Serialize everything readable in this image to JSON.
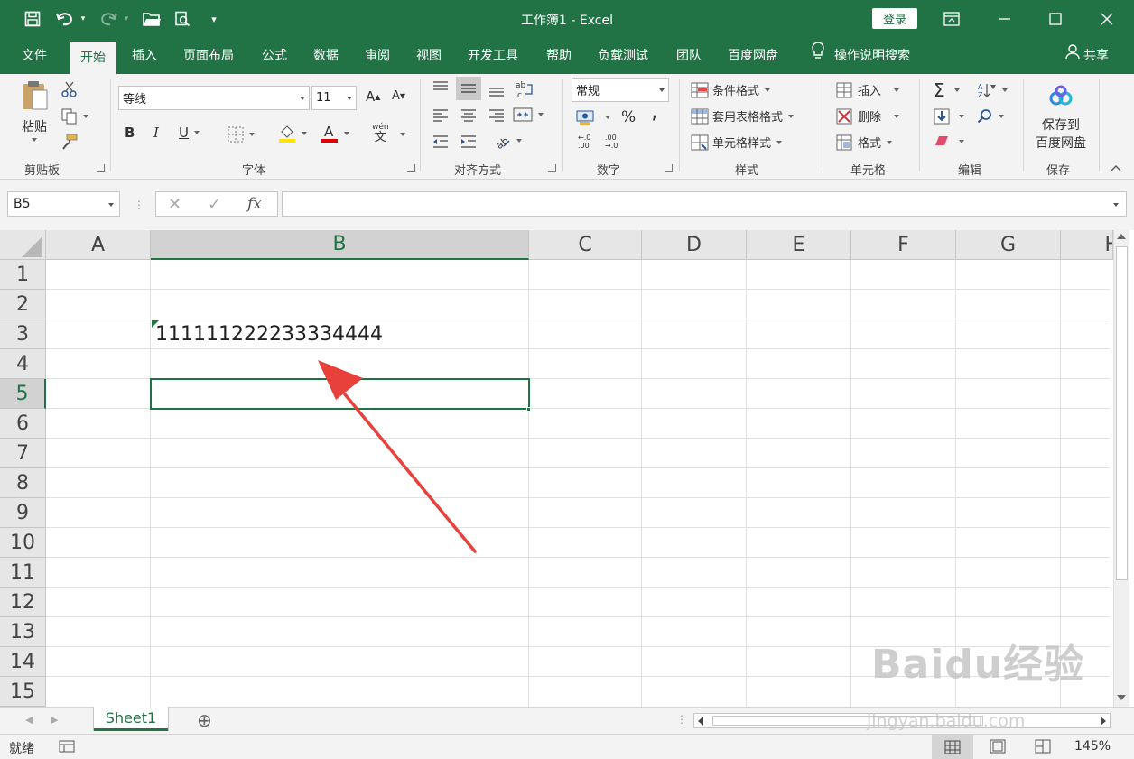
{
  "title": {
    "doc": "工作簿1",
    "sep": "-",
    "app": "Excel",
    "login": "登录"
  },
  "menu": {
    "tabs": [
      "文件",
      "开始",
      "插入",
      "页面布局",
      "公式",
      "数据",
      "审阅",
      "视图",
      "开发工具",
      "帮助",
      "负载测试",
      "团队",
      "百度网盘"
    ],
    "search": "操作说明搜索",
    "share": "共享"
  },
  "ribbon": {
    "clipboard": {
      "paste": "粘贴",
      "label": "剪贴板"
    },
    "font": {
      "name": "等线",
      "size": "11",
      "bold": "B",
      "italic": "I",
      "underline": "U",
      "grow": "A",
      "shrink": "A",
      "label": "字体",
      "phonetic_top": "wén",
      "phonetic_bottom": "文"
    },
    "alignment": {
      "label": "对齐方式"
    },
    "number": {
      "format": "常规",
      "percent": "%",
      "comma": ",",
      "inc_top": "←.0",
      "inc_bottom": ".00",
      "dec_top": ".00",
      "dec_bottom": "→.0",
      "label": "数字"
    },
    "styles": {
      "conditional": "条件格式",
      "table": "套用表格格式",
      "cell": "单元格样式",
      "label": "样式"
    },
    "cells": {
      "insert": "插入",
      "delete": "删除",
      "format": "格式",
      "label": "单元格"
    },
    "editing": {
      "label": "编辑"
    },
    "save": {
      "line1": "保存到",
      "line2": "百度网盘",
      "label": "保存"
    }
  },
  "formula_bar": {
    "name_box": "B5",
    "cancel": "✕",
    "enter": "✓",
    "fx": "fx",
    "value": ""
  },
  "grid": {
    "columns": [
      "A",
      "B",
      "C",
      "D",
      "E",
      "F",
      "G",
      "H"
    ],
    "rows": [
      "1",
      "2",
      "3",
      "4",
      "5",
      "6",
      "7",
      "8",
      "9",
      "10",
      "11",
      "12",
      "13",
      "14",
      "15"
    ],
    "selected_col": "B",
    "selected_row": "5",
    "cells": {
      "B3": "111111222233334444"
    }
  },
  "sheets": {
    "tabs": [
      "Sheet1"
    ],
    "add": "⊕"
  },
  "status": {
    "ready": "就绪",
    "zoom": "145%"
  },
  "watermark": {
    "brand": "Baidu经验",
    "url": "jingyan.baidu.com"
  },
  "colors": {
    "accent": "#217346",
    "arrow": "#e8403a"
  }
}
